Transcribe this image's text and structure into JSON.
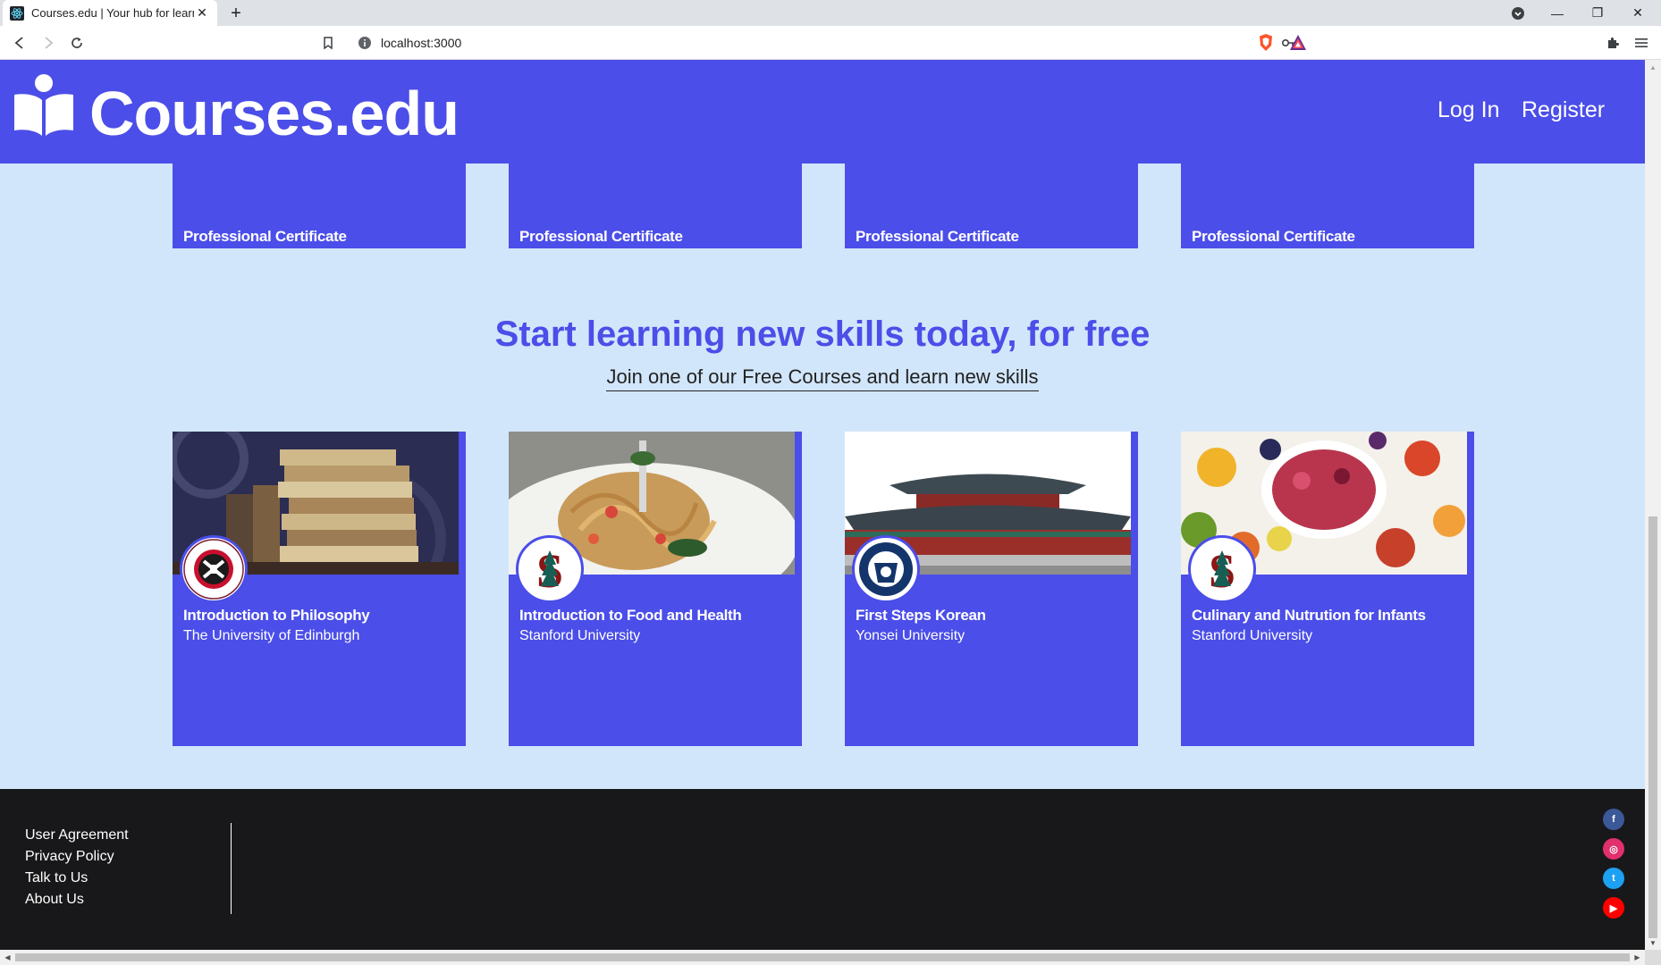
{
  "browser": {
    "tab_title": "Courses.edu | Your hub for learning",
    "tab_close": "✕",
    "new_tab": "+",
    "url": "localhost:3000",
    "controls": {
      "minimize": "—",
      "maximize": "❐",
      "close": "✕"
    }
  },
  "header": {
    "logo_text": "Courses.edu",
    "nav": {
      "login": "Log In",
      "register": "Register"
    },
    "brand_color": "#4b4ee8"
  },
  "certificates": [
    {
      "label": "Professional Certificate"
    },
    {
      "label": "Professional Certificate"
    },
    {
      "label": "Professional Certificate"
    },
    {
      "label": "Professional Certificate"
    }
  ],
  "free_section": {
    "title": "Start learning new skills today, for free",
    "subtitle": "Join one of our Free Courses and learn new skills"
  },
  "courses": [
    {
      "title": "Introduction to Philosophy",
      "university": "The University of Edinburgh",
      "image_icon": "books-image",
      "logo_icon": "edinburgh-logo-icon"
    },
    {
      "title": "Introduction to Food and Health",
      "university": "Stanford University",
      "image_icon": "pasta-image",
      "logo_icon": "stanford-logo-icon"
    },
    {
      "title": "First Steps Korean",
      "university": "Yonsei University",
      "image_icon": "korean-palace-image",
      "logo_icon": "yonsei-logo-icon"
    },
    {
      "title": "Culinary and Nutrution for Infants",
      "university": "Stanford University",
      "image_icon": "fruit-bowl-image",
      "logo_icon": "stanford-logo-icon"
    }
  ],
  "footer": {
    "links": [
      "User Agreement",
      "Privacy Policy",
      "Talk to Us",
      "About Us"
    ],
    "social": [
      {
        "name": "facebook-icon",
        "glyph": "f",
        "color": "#3b5998"
      },
      {
        "name": "instagram-icon",
        "glyph": "◎",
        "color": "#e1306c"
      },
      {
        "name": "twitter-icon",
        "glyph": "t",
        "color": "#1da1f2"
      },
      {
        "name": "youtube-icon",
        "glyph": "▶",
        "color": "#ff0000"
      }
    ]
  }
}
